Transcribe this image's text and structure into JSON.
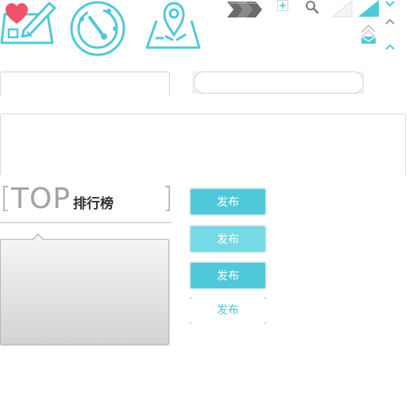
{
  "icons": {
    "edit_card": "edit-card-icon",
    "heart": "heart-icon",
    "gauge": "gauge-icon",
    "map_pin": "map-pin-icon",
    "chevron_stripe": "chevron-stripe-icon",
    "plus": "plus-icon",
    "search": "search-icon",
    "corner_light": "corner-triangle-icon",
    "corner_accent": "corner-accent-icon",
    "chevron_down": "chevron-down-icon",
    "chevron_up": "chevron-up-icon",
    "envelope": "envelope-icon"
  },
  "colors": {
    "accent": "#4fc9d9",
    "accent_hover": "#77d9e6",
    "heart": "#f2536a",
    "icon_dark": "#666666"
  },
  "heading": {
    "bracket_left": "[",
    "top": "TOP",
    "rank": "排行榜",
    "bracket_right": "]"
  },
  "buttons": {
    "publish_normal": "发布",
    "publish_hover": "发布",
    "publish_active": "发布",
    "publish_plain": "发布"
  }
}
